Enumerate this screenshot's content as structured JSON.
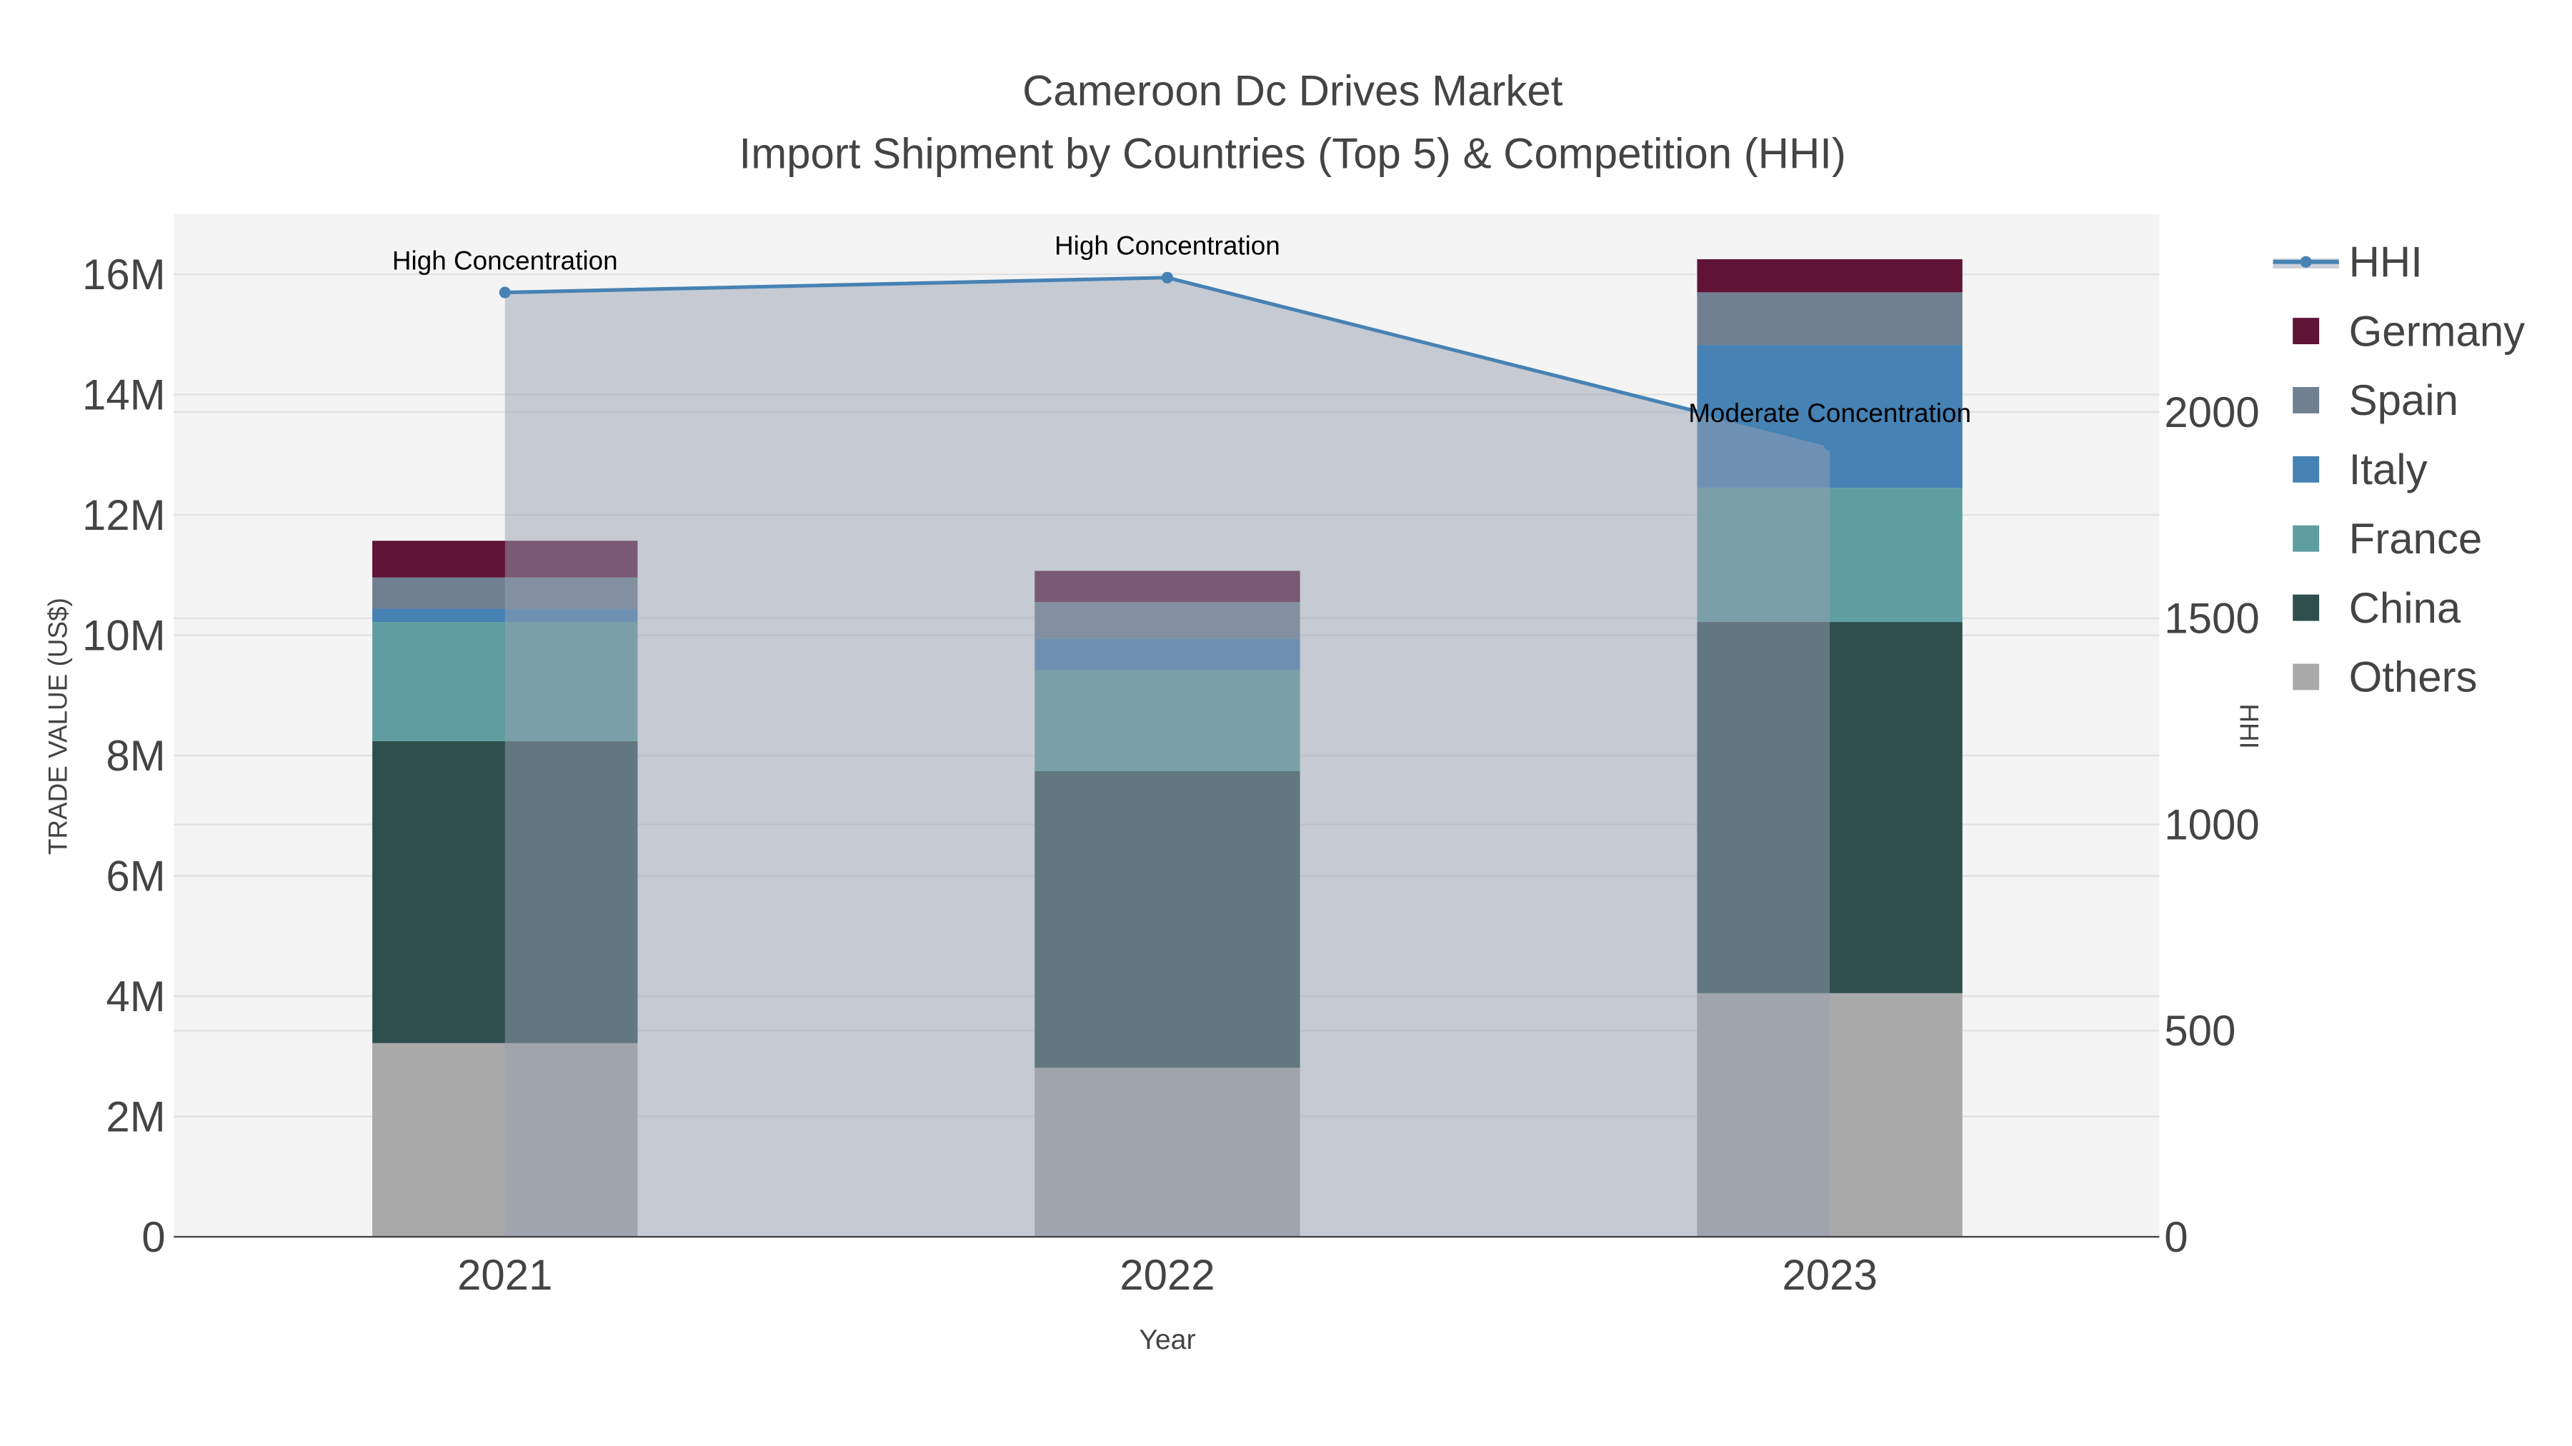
{
  "chart_data": {
    "type": "bar",
    "stacked": true,
    "title": "Cameroon Dc Drives Market",
    "subtitle": "Import Shipment by Countries (Top 5) & Competition (HHI)",
    "xlabel": "Year",
    "ylabel": "TRADE VALUE (US$)",
    "y2label": "HHI",
    "categories": [
      "2021",
      "2022",
      "2023"
    ],
    "ylim": [
      0,
      17000000
    ],
    "y_ticks": [
      0,
      2000000,
      4000000,
      6000000,
      8000000,
      10000000,
      12000000,
      14000000,
      16000000
    ],
    "y_tick_labels": [
      "0",
      "2M",
      "4M",
      "6M",
      "8M",
      "10M",
      "12M",
      "14M",
      "16M"
    ],
    "y2lim": [
      0,
      2480
    ],
    "y2_ticks": [
      0,
      500,
      1000,
      1500,
      2000
    ],
    "y2_tick_labels": [
      "0",
      "500",
      "1000",
      "1500",
      "2000"
    ],
    "grid": true,
    "legend_position": "right",
    "series": [
      {
        "name": "Others",
        "color": "#a9a9a9",
        "values": [
          3220000,
          2810000,
          4050000
        ]
      },
      {
        "name": "China",
        "color": "#2f4f4f",
        "values": [
          5020000,
          4930000,
          6170000
        ]
      },
      {
        "name": "France",
        "color": "#5f9ea0",
        "values": [
          1980000,
          1680000,
          2230000
        ]
      },
      {
        "name": "Italy",
        "color": "#4682b4",
        "values": [
          220000,
          520000,
          2370000
        ]
      },
      {
        "name": "Spain",
        "color": "#708090",
        "values": [
          520000,
          610000,
          880000
        ]
      },
      {
        "name": "Germany",
        "color": "#5f1336",
        "values": [
          610000,
          520000,
          550000
        ]
      }
    ],
    "line_series": {
      "name": "HHI",
      "color": "#4682b4",
      "values": [
        2290,
        2326,
        1920
      ],
      "annotations": [
        "High Concentration",
        "High Concentration",
        "Moderate Concentration"
      ]
    },
    "legend_order": [
      "HHI",
      "Germany",
      "Spain",
      "Italy",
      "France",
      "China",
      "Others"
    ]
  }
}
